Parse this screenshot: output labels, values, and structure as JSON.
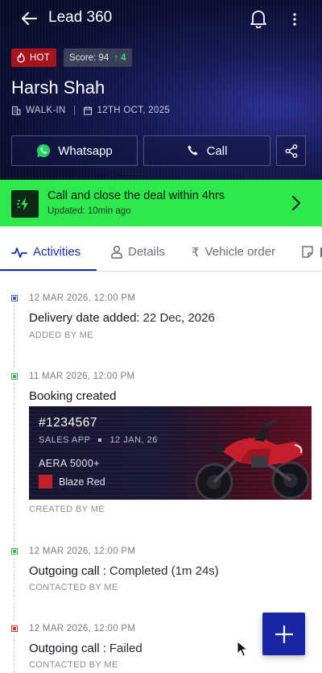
{
  "header": {
    "title": "Lead 360",
    "hot_label": "HOT",
    "score_label": "Score: 94",
    "score_delta": "↑ 4",
    "lead_name": "Harsh Shah",
    "source": "WALK-IN",
    "date": "12TH OCT, 2025",
    "whatsapp_label": "Whatsapp",
    "call_label": "Call"
  },
  "banner": {
    "title": "Call and close the deal within 4hrs",
    "updated": "Updated: 10min ago"
  },
  "tabs": [
    {
      "label": "Activities"
    },
    {
      "label": "Details"
    },
    {
      "label": "Vehicle order"
    }
  ],
  "timeline": [
    {
      "time": "12 MAR 2026, 12:00 PM",
      "title": "Delivery date added:",
      "value": "22 Dec, 2026",
      "by": "ADDED BY ME",
      "status": "blue"
    },
    {
      "time": "11 MAR 2026, 12:00 PM",
      "title": "Booking created",
      "value": "",
      "by": "CREATED BY ME",
      "status": "green"
    },
    {
      "time": "12 MAR 2026, 12:00 PM",
      "title": "Outgoing call :",
      "value": "Completed (1m 24s)",
      "by": "CONTACTED BY ME",
      "status": "green"
    },
    {
      "time": "12 MAR 2026, 12:00 PM",
      "title": "Outgoing call :",
      "value": "Failed",
      "by": "CONTACTED BY ME",
      "status": "red"
    }
  ],
  "booking_card": {
    "id": "#1234567",
    "source": "SALES APP",
    "date": "12 JAN, 26",
    "model": "AERA 5000+",
    "color_name": "Blaze Red",
    "color_hex": "#c61f2c"
  },
  "colors": {
    "accent": "#1a2aa6",
    "banner": "#2ee84e",
    "hot": "#a8141e"
  }
}
